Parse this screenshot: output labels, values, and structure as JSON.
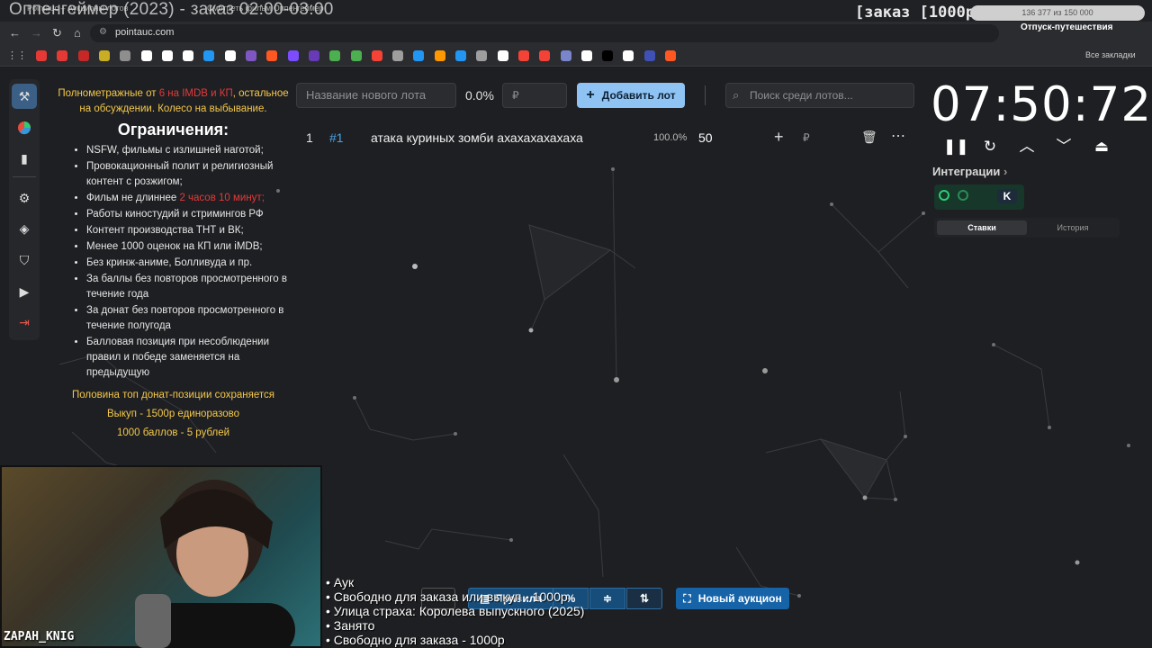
{
  "overlay": {
    "stream_title": "Оппенгеймер (2023) - заказ 02:00-03:00",
    "order_badge": "[заказ [1000р]",
    "goal_progress": "136 377 из 150 000",
    "goal_name": "Отпуск-путешествия",
    "cam_name": "ZAPAH_KNIG",
    "playlist": [
      "• Аук",
      "• Свободно для заказа или выкуп - 1000р",
      "• Улица страха: Королева выпускного (2025)",
      "• Занято",
      "• Свободно для заказа - 1000р"
    ]
  },
  "browser": {
    "tabs": [
      "Pointauc – Аукционы лотов",
      "Смотреть фильм Оппенгеймер"
    ],
    "url": "pointauc.com",
    "all_bookmarks": "Все закладки"
  },
  "rules": {
    "intro_a": "Полнометражные от ",
    "intro_red": "6 на IMDB и КП",
    "intro_b": ", остальное на обсуждении. Колесо на выбывание.",
    "title": "Ограничения:",
    "items": [
      {
        "a": "NSFW, фильмы с излишней наготой;",
        "red": "",
        "b": ""
      },
      {
        "a": "Провокационный полит и религиозный контент с розжигом;",
        "red": "",
        "b": ""
      },
      {
        "a": "Фильм не длиннее ",
        "red": "2 часов 10 минут;",
        "b": ""
      },
      {
        "a": "Работы киностудий и стримингов РФ",
        "red": "",
        "b": ""
      },
      {
        "a": "Контент производства ТНТ и ВК;",
        "red": "",
        "b": ""
      },
      {
        "a": "Менее 1000 оценок на КП или iMDB;",
        "red": "",
        "b": ""
      },
      {
        "a": "Без кринж-аниме, Болливуда и пр.",
        "red": "",
        "b": ""
      },
      {
        "a": "За баллы без повторов просмотренного в течение года",
        "red": "",
        "b": ""
      },
      {
        "a": "За донат без повторов просмотренного в течение полугода",
        "red": "",
        "b": ""
      },
      {
        "a": "Балловая позиция при несоблюдении правил и победе заменяется на предыдущую",
        "red": "",
        "b": ""
      }
    ],
    "footer": [
      "Половина топ донат-позиции сохраняется",
      "Выкуп - 1500р единоразово",
      "1000 баллов - 5 рублей"
    ]
  },
  "controls": {
    "lot_placeholder": "Название нового лота",
    "percent": "0.0%",
    "currency": "₽",
    "add_lot": "Добавить лот",
    "search_placeholder": "Поиск среди лотов..."
  },
  "lot": {
    "index": "1",
    "tag": "#1",
    "name": "атака куриных зомби ахахахахахаха",
    "percent": "100.0%",
    "amount": "50",
    "currency": "₽"
  },
  "timer": {
    "value": "07:50:72",
    "integrations": "Интеграции",
    "tab_bids": "Ставки",
    "tab_history": "История"
  },
  "bottom": {
    "rules_btn": "Правила",
    "min_amount": "1000р",
    "new_auction": "Новый аукцион"
  },
  "colors": {
    "accent": "#8fc3f3",
    "primary_button": "#1663a8",
    "warning_text": "#f4c84a",
    "danger_text": "#e23a3a"
  }
}
